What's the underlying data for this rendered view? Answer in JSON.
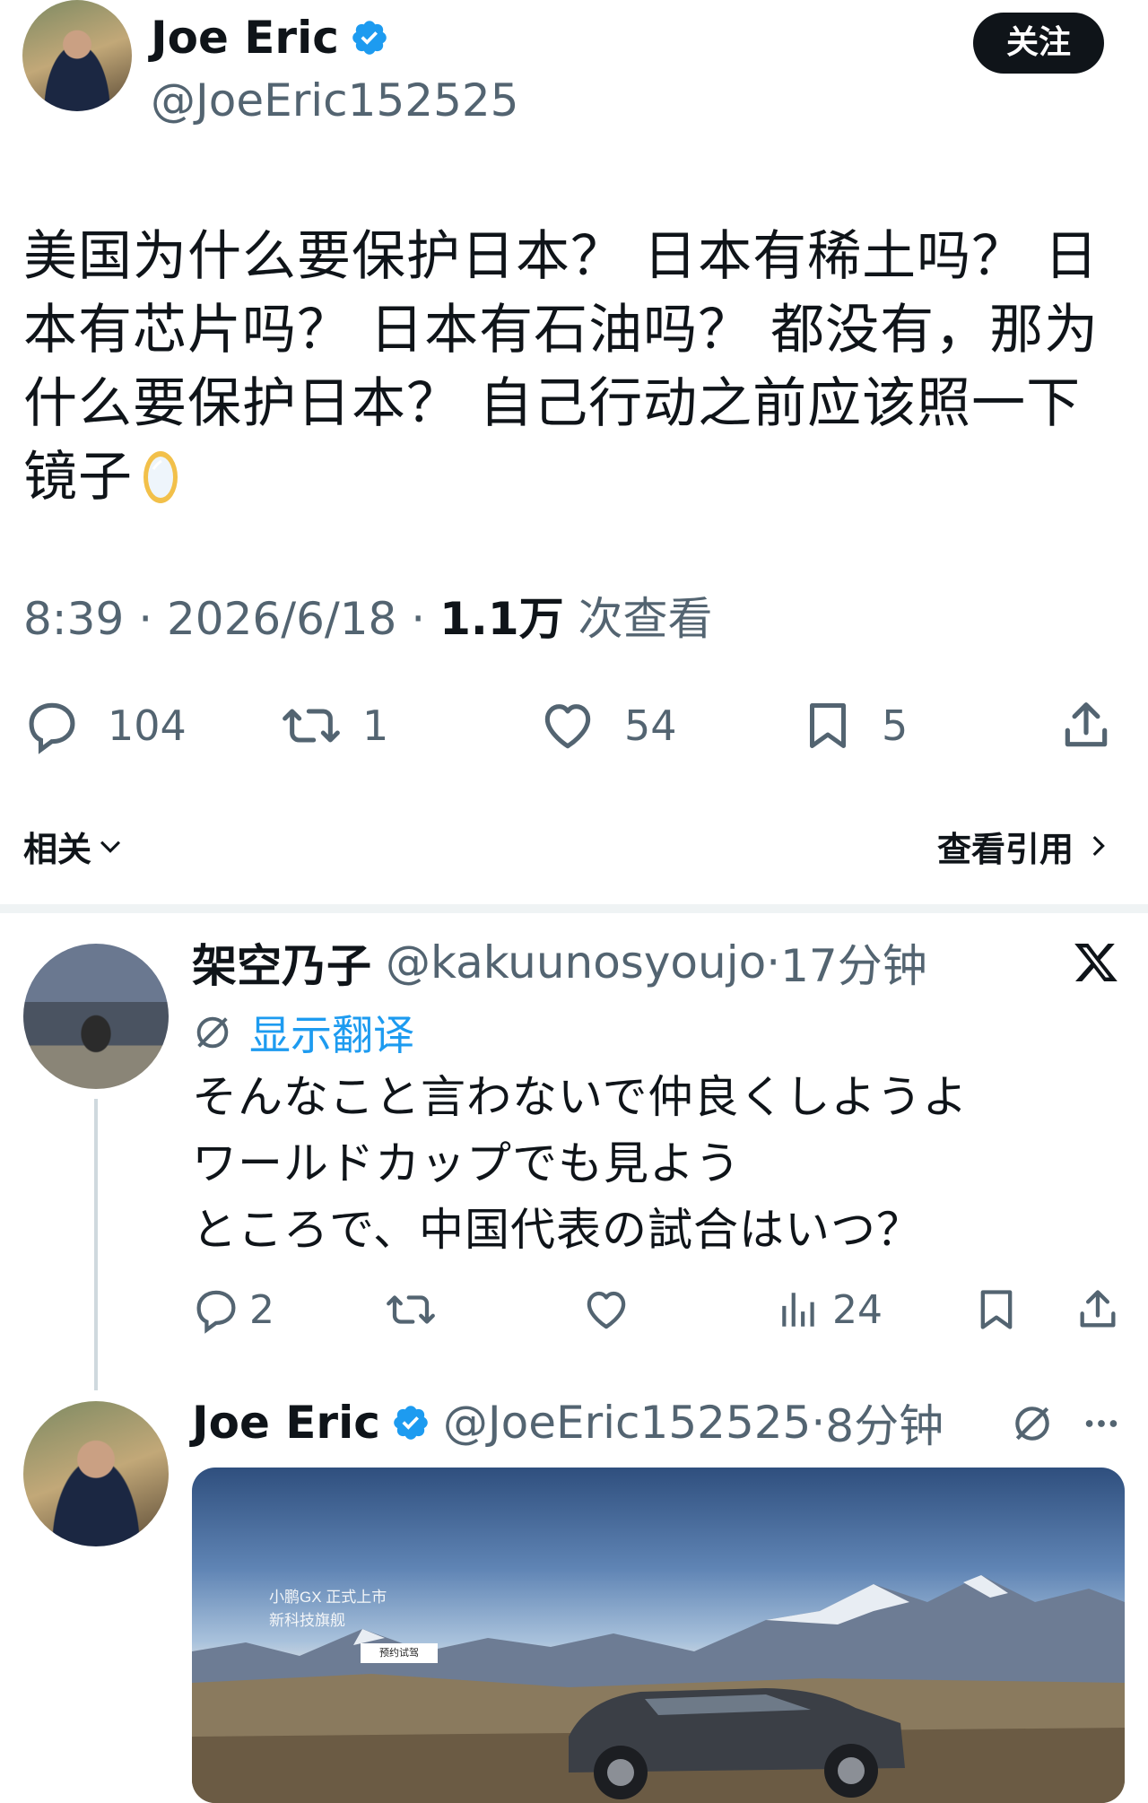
{
  "tweet": {
    "author_name": "Joe Eric",
    "author_handle": "@JoeEric152525",
    "follow_label": "关注",
    "text_lines": [
      "美国为什么要保护日本？ 日本有稀土吗？ 日",
      "本有芯片吗？ 日本有石油吗？ 都没有，那为",
      "什么要保护日本？ 自己行动之前应该照一下",
      "镜子"
    ],
    "emoji_name": "mirror-emoji",
    "time": "8:39",
    "date": "2026/6/18",
    "views_count": "1.1万",
    "views_label": "次查看",
    "replies": "104",
    "retweets": "1",
    "likes": "54",
    "bookmarks": "5"
  },
  "related_bar": {
    "related_label": "相关",
    "quotes_label": "查看引用"
  },
  "reply": {
    "author_name": "架空乃子",
    "author_handle": "@kakuunosyoujo",
    "time_ago": "17分钟",
    "translate_label": "显示翻译",
    "text_lines": [
      "そんなこと言わないで仲良くしようよ",
      "ワールドカップでも見よう",
      "ところで、中国代表の試合はいつ？"
    ],
    "replies": "2",
    "views": "24"
  },
  "reply2": {
    "author_name": "Joe Eric",
    "author_handle": "@JoeEric152525",
    "time_ago": "8分钟",
    "image": {
      "ad_line1": "小鹏GX 正式上市",
      "ad_line2": "新科技旗舰",
      "ad_button": "预约试驾"
    }
  },
  "icons": [
    "verified-badge-icon",
    "reply-icon",
    "retweet-icon",
    "like-icon",
    "bookmark-icon",
    "share-icon",
    "chevron-down-icon",
    "chevron-right-icon",
    "x-logo-icon",
    "translate-icon",
    "views-icon",
    "more-icon"
  ],
  "colors": {
    "accent": "#1d9bf0",
    "text": "#0f1419",
    "secondary": "#536471"
  }
}
